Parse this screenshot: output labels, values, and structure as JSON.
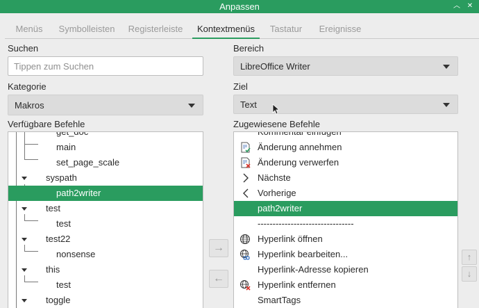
{
  "window": {
    "title": "Anpassen"
  },
  "tabs": [
    {
      "label": "Menüs",
      "active": false
    },
    {
      "label": "Symbolleisten",
      "active": false
    },
    {
      "label": "Registerleiste",
      "active": false
    },
    {
      "label": "Kontextmenüs",
      "active": true
    },
    {
      "label": "Tastatur",
      "active": false
    },
    {
      "label": "Ereignisse",
      "active": false
    }
  ],
  "left": {
    "search_label": "Suchen",
    "search_placeholder": "Tippen zum Suchen",
    "category_label": "Kategorie",
    "category_value": "Makros",
    "available_label": "Verfügbare Befehle",
    "tree": {
      "partial_top": "get_doc",
      "items": [
        {
          "label": "main"
        },
        {
          "label": "set_page_scale"
        },
        {
          "label": "syspath"
        },
        {
          "label": "path2writer"
        },
        {
          "label": "test"
        },
        {
          "label": "test"
        },
        {
          "label": "test22"
        },
        {
          "label": "nonsense"
        },
        {
          "label": "this"
        },
        {
          "label": "test"
        },
        {
          "label": "toggle"
        }
      ]
    }
  },
  "right": {
    "scope_label": "Bereich",
    "scope_value": "LibreOffice Writer",
    "target_label": "Ziel",
    "target_value": "Text",
    "assigned_label": "Zugewiesene Befehle",
    "partial_top": "Kommentar einfügen",
    "items": [
      {
        "label": "Änderung annehmen",
        "icon": "accept-change-icon"
      },
      {
        "label": "Änderung verwerfen",
        "icon": "reject-change-icon"
      },
      {
        "label": "Nächste",
        "icon": "chevron-right-icon"
      },
      {
        "label": "Vorherige",
        "icon": "chevron-left-icon"
      },
      {
        "label": "path2writer",
        "icon": ""
      },
      {
        "label": "--------------------------------",
        "icon": ""
      },
      {
        "label": "Hyperlink öffnen",
        "icon": "globe-icon"
      },
      {
        "label": "Hyperlink bearbeiten...",
        "icon": "globe-edit-icon"
      },
      {
        "label": "Hyperlink-Adresse kopieren",
        "icon": ""
      },
      {
        "label": "Hyperlink entfernen",
        "icon": "globe-remove-icon"
      },
      {
        "label": "SmartTags",
        "icon": ""
      }
    ]
  },
  "buttons": {
    "add": "→",
    "remove": "←",
    "move_up": "↑",
    "move_down": "↓"
  }
}
